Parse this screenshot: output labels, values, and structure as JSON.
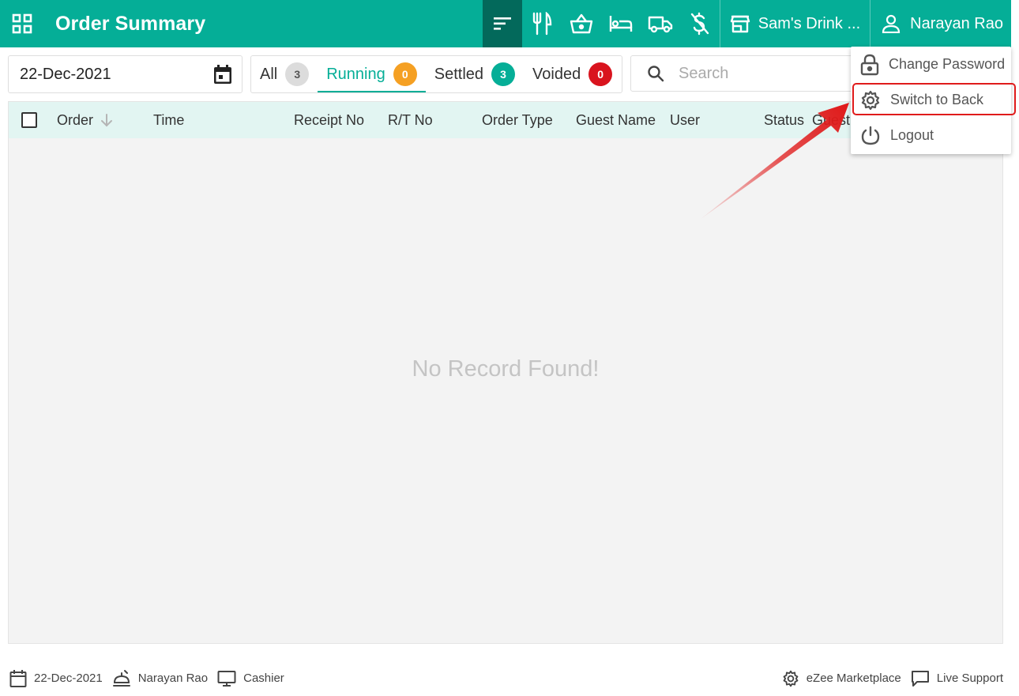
{
  "header": {
    "title": "Order Summary",
    "outlet_name": "Sam's Drink ...",
    "user_name": "Narayan Rao",
    "nav_icons": [
      "filter-list-icon",
      "restaurant-icon",
      "basket-icon",
      "bed-icon",
      "truck-icon",
      "money-off-icon"
    ]
  },
  "filters": {
    "date": "22-Dec-2021",
    "tabs": [
      {
        "label": "All",
        "count": "3"
      },
      {
        "label": "Running",
        "count": "0"
      },
      {
        "label": "Settled",
        "count": "3"
      },
      {
        "label": "Voided",
        "count": "0"
      }
    ],
    "active_tab": "Running",
    "search_placeholder": "Search"
  },
  "table": {
    "columns": [
      "Order",
      "Time",
      "Receipt No",
      "R/T No",
      "Order Type",
      "Guest Name",
      "User",
      "Status",
      "Guest"
    ],
    "empty_message": "No Record Found!"
  },
  "user_menu": {
    "items": [
      "Change Password",
      "Switch to Back",
      "Logout"
    ],
    "highlighted": "Switch to Back"
  },
  "footer": {
    "date": "22-Dec-2021",
    "user": "Narayan Rao",
    "terminal": "Cashier",
    "marketplace": "eZee Marketplace",
    "support": "Live Support"
  },
  "colors": {
    "brand": "#05ae97",
    "brand_dark": "#03695b",
    "running": "#f5a023",
    "voided": "#d9141e",
    "annotation": "#e01b1b"
  }
}
